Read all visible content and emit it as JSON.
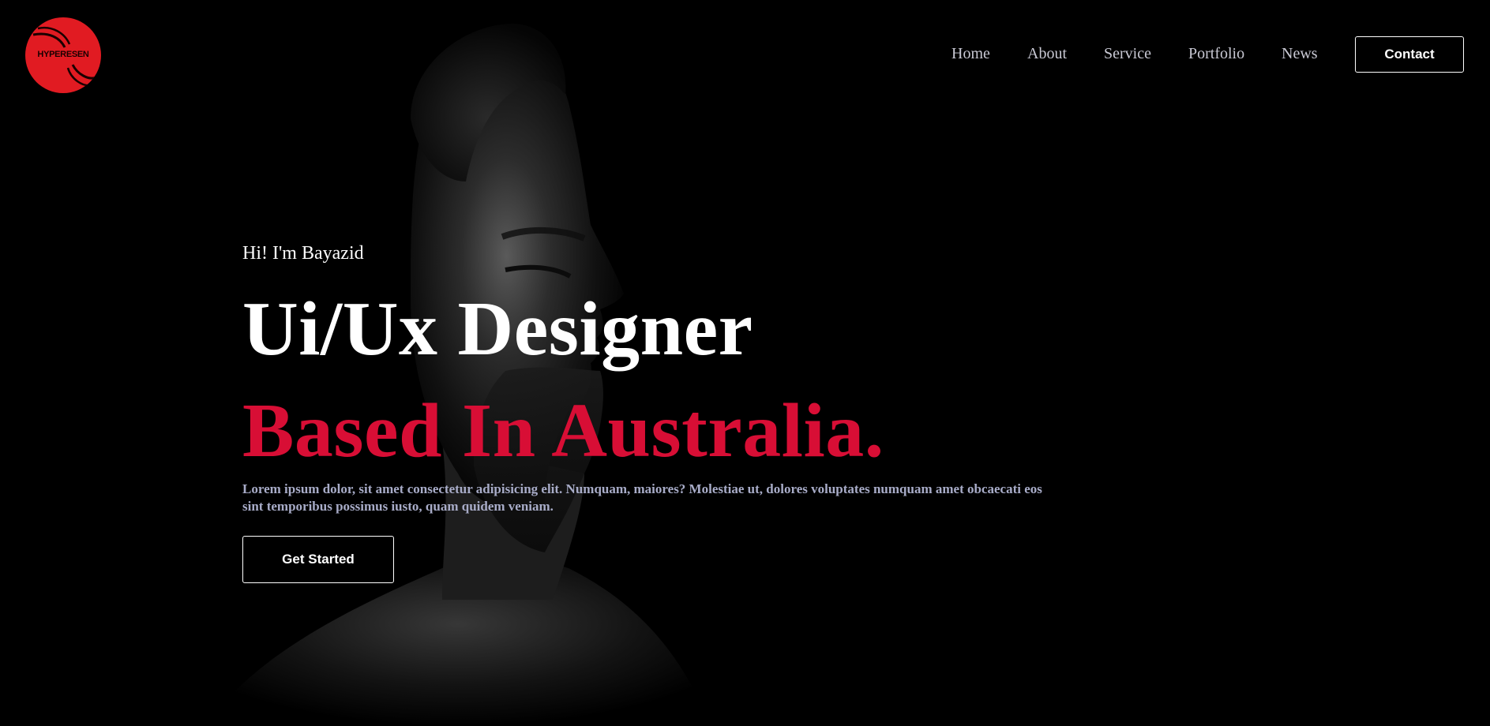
{
  "brand": {
    "logo_text": "HYPERESEN",
    "logo_color": "#e11b22"
  },
  "nav": {
    "items": [
      {
        "label": "Home"
      },
      {
        "label": "About"
      },
      {
        "label": "Service"
      },
      {
        "label": "Portfolio"
      },
      {
        "label": "News"
      }
    ],
    "contact_label": "Contact"
  },
  "hero": {
    "greeting": "Hi! I'm Bayazid",
    "headline_line1": "Ui/Ux Designer",
    "headline_line2": "Based In Australia.",
    "description": "Lorem ipsum dolor, sit amet consectetur adipisicing elit. Numquam, maiores? Molestiae ut, dolores voluptates numquam amet obcaecati eos sint temporibus possimus iusto, quam quidem veniam.",
    "cta_label": "Get Started",
    "accent_color": "#d80e35",
    "background_image": "dark-profile-portrait"
  }
}
